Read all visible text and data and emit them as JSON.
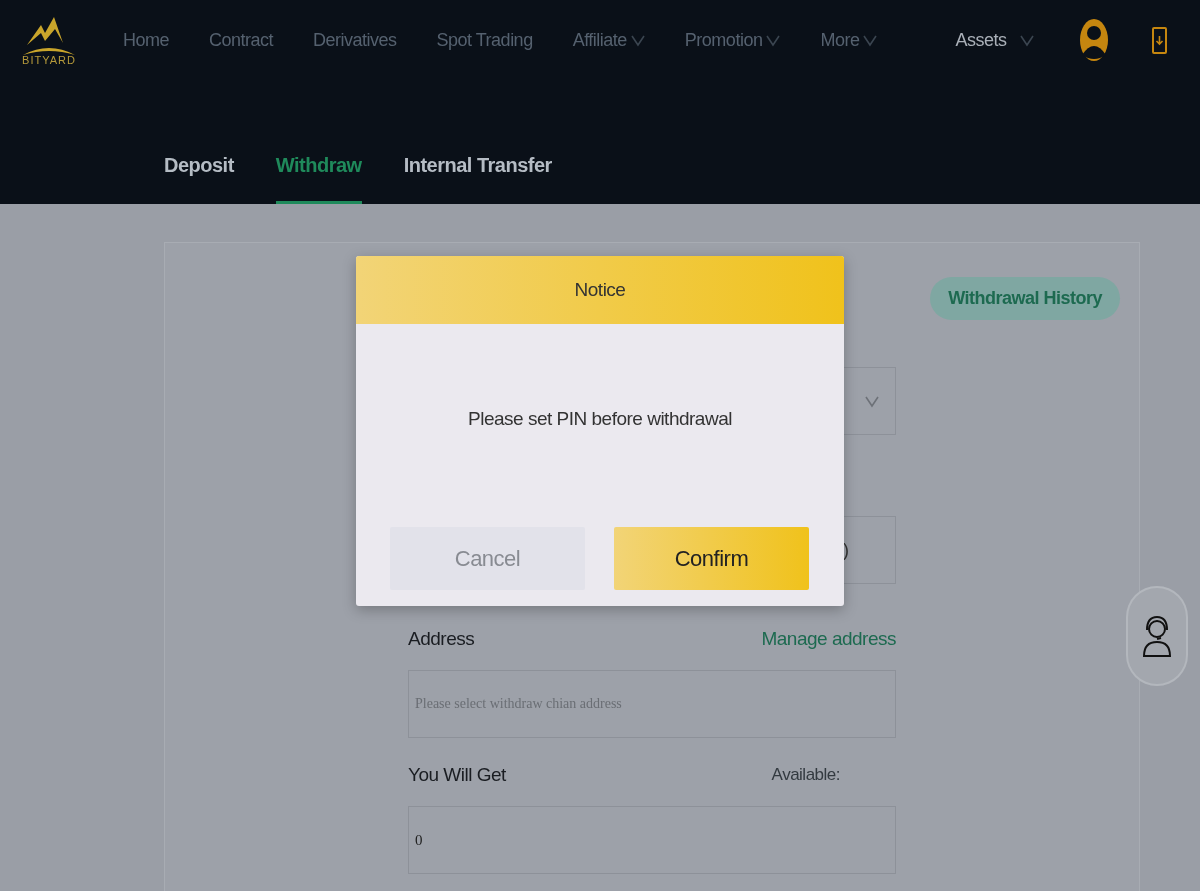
{
  "header": {
    "brand": "BITYARD",
    "nav": [
      {
        "label": "Home",
        "dropdown": false
      },
      {
        "label": "Contract",
        "dropdown": false
      },
      {
        "label": "Derivatives",
        "dropdown": false
      },
      {
        "label": "Spot Trading",
        "dropdown": false
      },
      {
        "label": "Affiliate",
        "dropdown": true
      },
      {
        "label": "Promotion",
        "dropdown": true
      },
      {
        "label": "More",
        "dropdown": true
      }
    ],
    "assets": {
      "label": "Assets",
      "dropdown": true
    }
  },
  "tabs": [
    {
      "label": "Deposit",
      "selected": false
    },
    {
      "label": "Withdraw",
      "selected": true
    },
    {
      "label": "Internal Transfer",
      "selected": false
    }
  ],
  "form": {
    "history_button": "Withdrawal History",
    "fields": [
      {
        "kind": "select"
      },
      {
        "kind": "input",
        "value": ")"
      }
    ],
    "address_label": "Address",
    "manage_link": "Manage address",
    "address_placeholder": "Please select withdraw chian address",
    "get_label": "You Will Get",
    "available_label": "Available:",
    "get_value": "0"
  },
  "modal": {
    "title": "Notice",
    "message": "Please set PIN before withdrawal",
    "buttons": [
      {
        "label": "Cancel",
        "kind": "secondary"
      },
      {
        "label": "Confirm",
        "kind": "primary"
      }
    ]
  }
}
